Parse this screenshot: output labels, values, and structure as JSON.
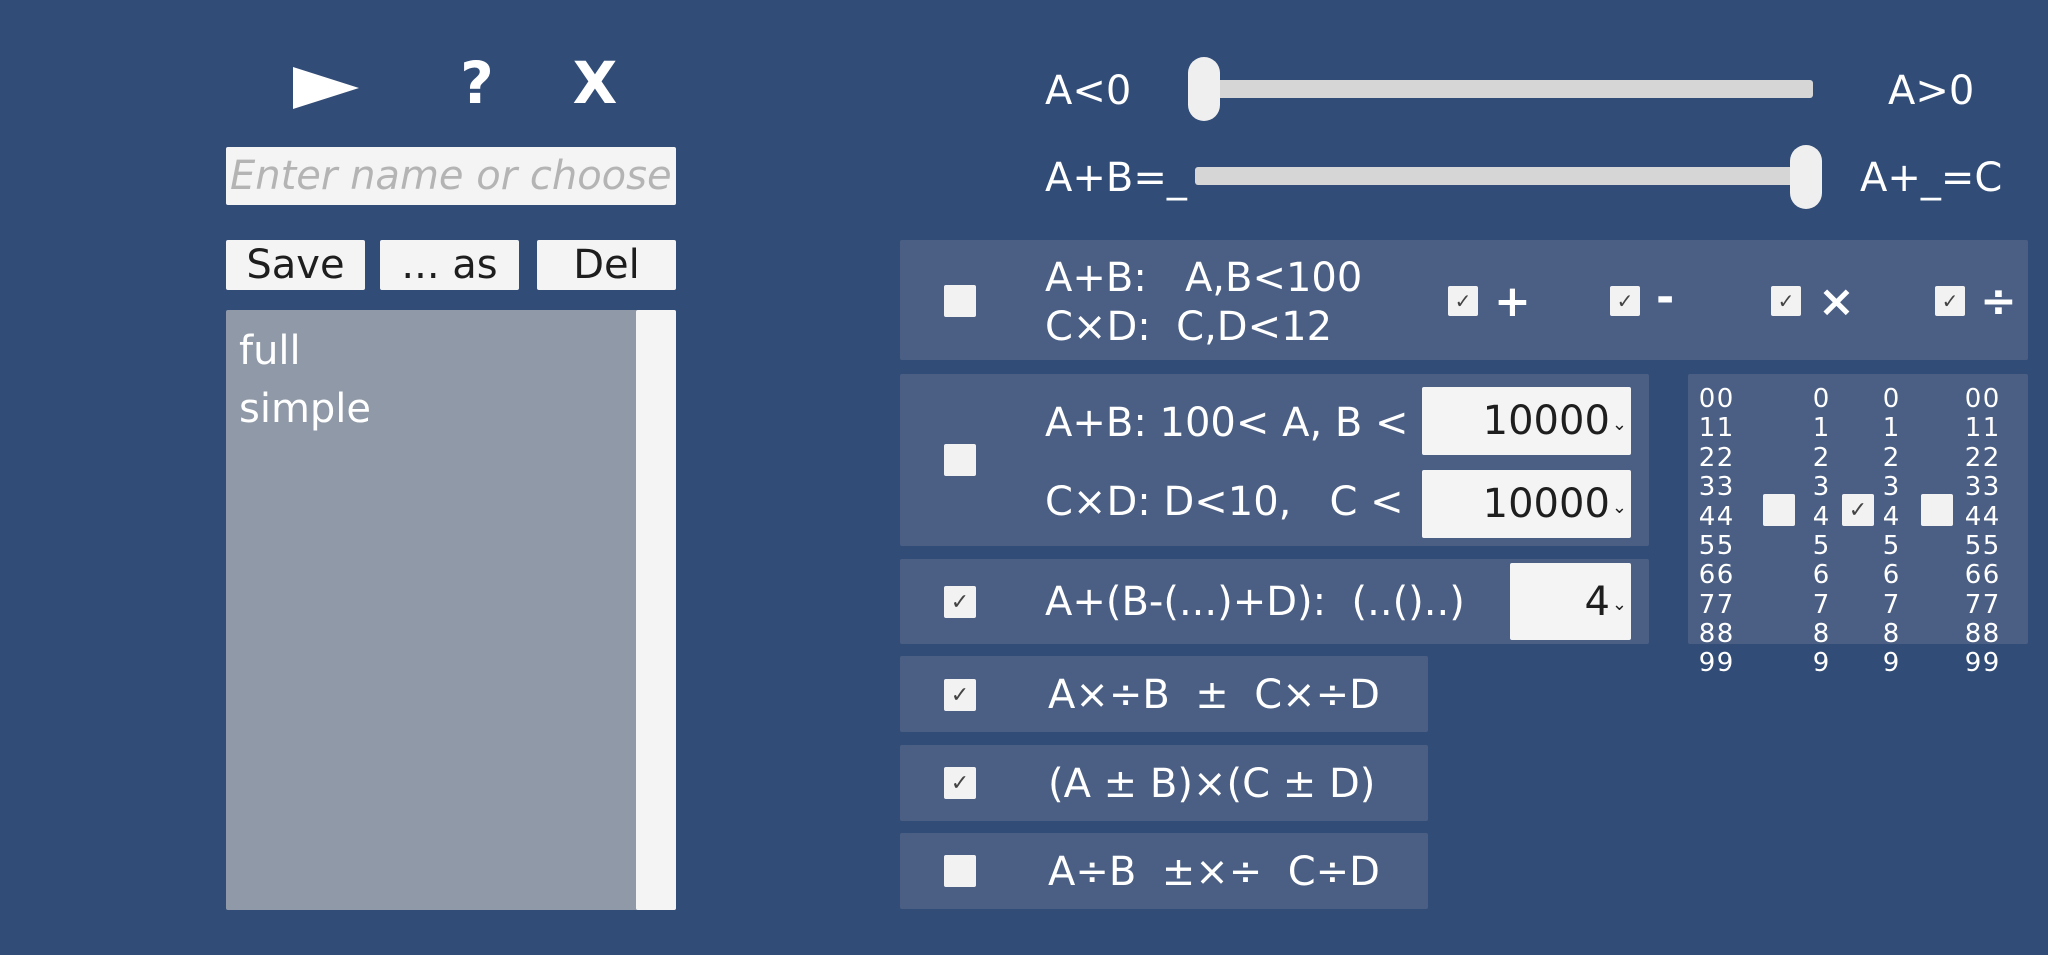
{
  "toolbar": {
    "play_icon": "play-icon",
    "help_label": "?",
    "close_label": "X"
  },
  "preset": {
    "placeholder": "Enter name or choose",
    "save_label": "Save",
    "save_as_label": "... as",
    "delete_label": "Del",
    "items": [
      "full",
      "simple"
    ]
  },
  "sliders": [
    {
      "left_label": "A<0",
      "right_label": "A>0",
      "value": 0.0
    },
    {
      "left_label": "A+B=_",
      "right_label": "A+_=C",
      "value": 1.0
    }
  ],
  "row1": {
    "checked": false,
    "line1": "A+B:   A,B<100",
    "line2": "C×D:  C,D<12",
    "ops": [
      {
        "symbol": "+",
        "checked": true
      },
      {
        "symbol": "-",
        "checked": true
      },
      {
        "symbol": "×",
        "checked": true
      },
      {
        "symbol": "÷",
        "checked": true
      }
    ]
  },
  "row2": {
    "checked": false,
    "line1": "A+B: 100< A, B <",
    "line1_value": "10000",
    "line2": "C×D: D<10,   C <",
    "line2_value": "10000"
  },
  "row3": {
    "checked": true,
    "label": "A+(B-(...)+D):  (..()..)",
    "value": "4"
  },
  "row4": {
    "checked": true,
    "label": "A×÷B  ±  C×÷D"
  },
  "row5": {
    "checked": true,
    "label": "(A ± B)×(C ± D)"
  },
  "row6": {
    "checked": false,
    "label": "A÷B  ±×÷  C÷D"
  },
  "digits": {
    "checks": [
      false,
      true,
      false
    ],
    "column": [
      "0",
      "1",
      "2",
      "3",
      "4",
      "5",
      "6",
      "7",
      "8",
      "9"
    ]
  },
  "colors": {
    "background": "#314c77",
    "panel": "#4b5f84",
    "list": "#9099a8"
  }
}
